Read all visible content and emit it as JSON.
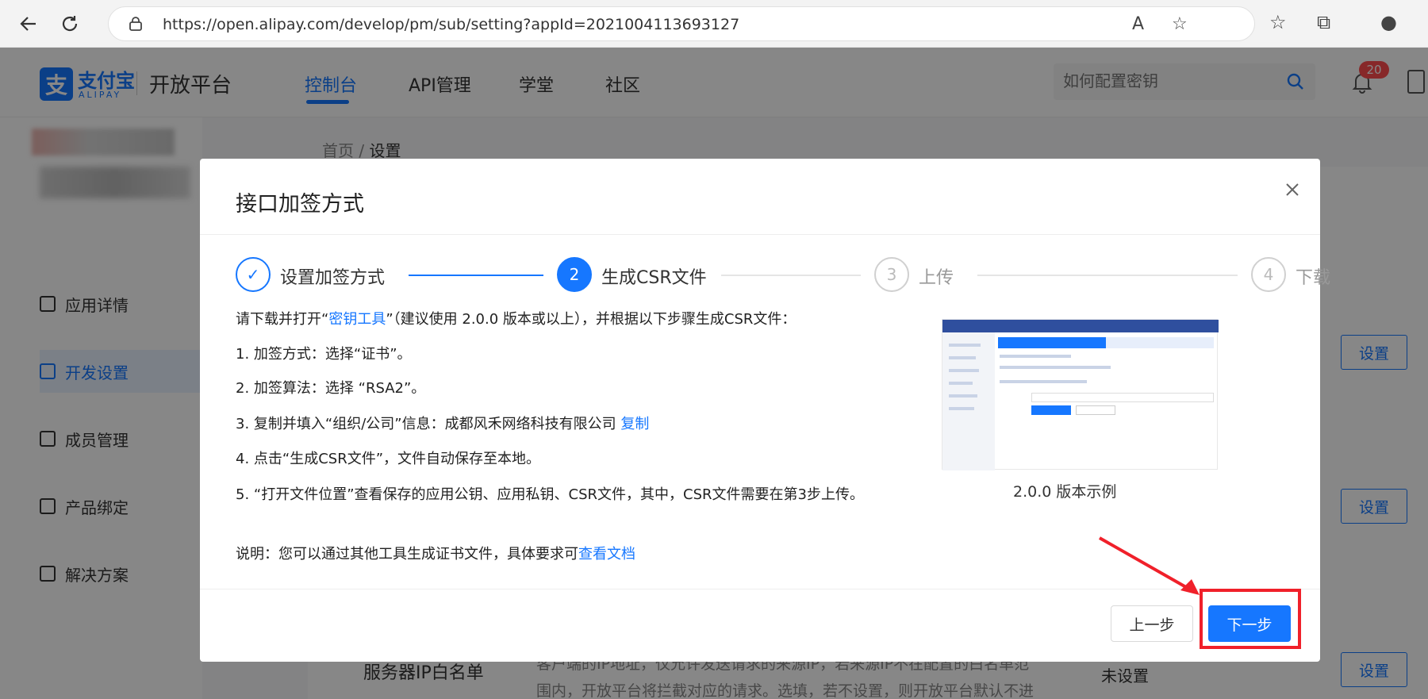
{
  "browser": {
    "url": "https://open.alipay.com/develop/pm/sub/setting?appId=2021004113693127"
  },
  "header": {
    "logo_mark": "支",
    "logo_cn": "支付宝",
    "logo_en": "ALIPAY",
    "platform": "开放平台",
    "nav": [
      "控制台",
      "API管理",
      "学堂",
      "社区"
    ],
    "search_placeholder": "如何配置密钥",
    "notification_count": "20"
  },
  "sidebar": {
    "items": [
      "应用详情",
      "开发设置",
      "成员管理",
      "产品绑定",
      "解决方案"
    ]
  },
  "breadcrumb": {
    "home": "首页",
    "sep": "/",
    "current": "设置"
  },
  "content": {
    "set_label": "设置",
    "row_label": "服务器IP白名单",
    "row_desc_1": "客户端的IP地址，仅允许发送请求的来源IP，若来源IP不在配置的白名单范",
    "row_desc_2": "围内，开放平台将拦截对应的请求。选填，若不设置，则开放平台默认不进",
    "row_status": "未设置"
  },
  "modal": {
    "title": "接口加签方式",
    "steps": [
      {
        "num": "✓",
        "label": "设置加签方式",
        "state": "done"
      },
      {
        "num": "2",
        "label": "生成CSR文件",
        "state": "current"
      },
      {
        "num": "3",
        "label": "上传",
        "state": "wait"
      },
      {
        "num": "4",
        "label": "下载",
        "state": "wait"
      }
    ],
    "intro_prefix": "请下载并打开“",
    "intro_link": "密钥工具",
    "intro_suffix": "”（建议使用 2.0.0 版本或以上），并根据以下步骤生成CSR文件：",
    "step1": "1. 加签方式：选择“证书”。",
    "step2": "2. 加签算法：选择 “RSA2”。",
    "step3_prefix": "3. 复制并填入“组织/公司”信息：成都风禾网络科技有限公司 ",
    "step3_link": "复制",
    "step4": "4. 点击“生成CSR文件”，文件自动保存至本地。",
    "step5": "5. “打开文件位置”查看保存的应用公钥、应用私钥、CSR文件，其中，CSR文件需要在第3步上传。",
    "note_prefix": "说明：您可以通过其他工具生成证书文件，具体要求可",
    "note_link": "查看文档",
    "preview_caption": "2.0.0 版本示例",
    "prev_label": "上一步",
    "next_label": "下一步"
  },
  "colors": {
    "primary": "#1677ff",
    "highlight": "#f0202a"
  }
}
